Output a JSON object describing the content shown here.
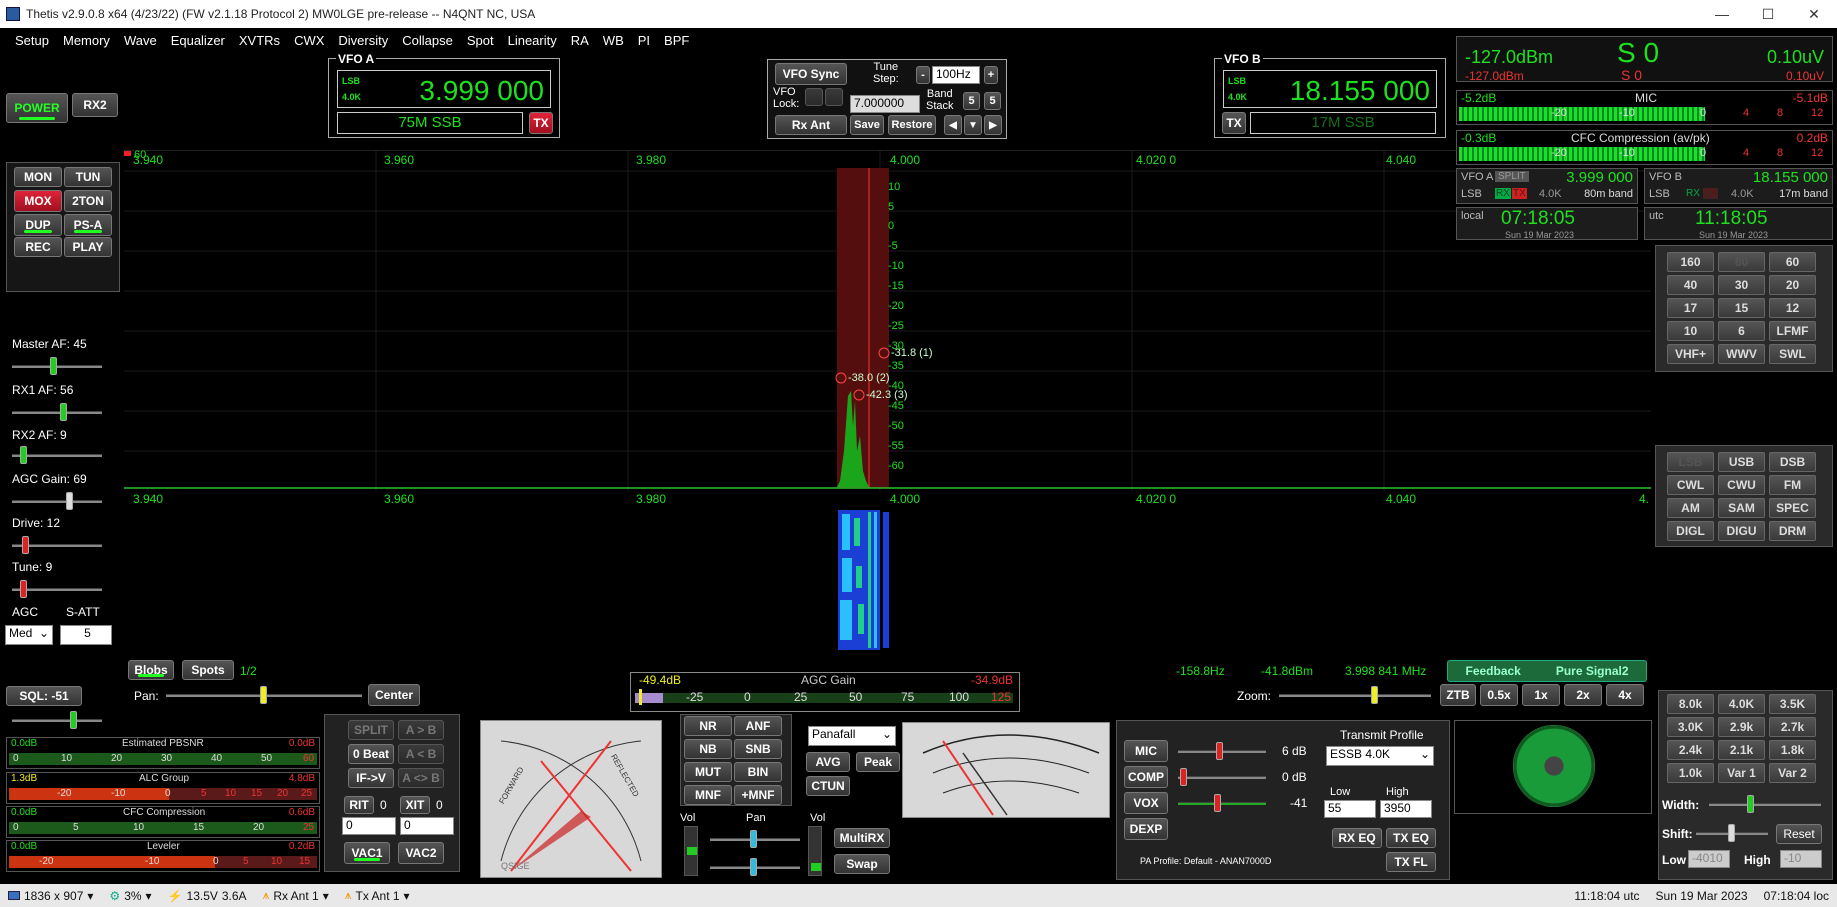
{
  "titlebar": {
    "title": "Thetis v2.9.0.8 x64 (4/23/22) (FW v2.1.18 Protocol 2) MW0LGE pre-release  --  N4QNT  NC, USA",
    "min": "—",
    "max": "☐",
    "close": "✕"
  },
  "menu": [
    "Setup",
    "Memory",
    "Wave",
    "Equalizer",
    "XVTRs",
    "CWX",
    "Diversity",
    "Collapse",
    "Spot",
    "Linearity",
    "RA",
    "WB",
    "PI",
    "BPF"
  ],
  "left": {
    "power": "POWER",
    "rx2": "RX2",
    "mon": "MON",
    "tun": "TUN",
    "mox": "MOX",
    "ton2": "2TON",
    "dup": "DUP",
    "psa": "PS-A",
    "rec": "REC",
    "play": "PLAY",
    "master_af": "Master AF:  45",
    "rx1_af": "RX1 AF:  56",
    "rx2_af": "RX2 AF:  9",
    "agc_gain": "AGC Gain:  69",
    "drive": "Drive:  12",
    "tune": "Tune:  9",
    "agc": "AGC",
    "satt": "S-ATT",
    "agc_mode": "Med",
    "satt_val": "5",
    "sql": "SQL:  -51"
  },
  "vfo_a": {
    "title": "VFO A",
    "mode": "LSB",
    "filter": "4.0K",
    "freq": "3.999 000",
    "band": "75M SSB",
    "tx": "TX"
  },
  "vfo_b": {
    "title": "VFO B",
    "mode": "LSB",
    "filter": "4.0K",
    "freq": "18.155 000",
    "band": "17M SSB",
    "tx": "TX"
  },
  "vfo_center": {
    "sync": "VFO Sync",
    "tune_step_label": "Tune\nStep:",
    "tune_step": "100Hz",
    "minus": "-",
    "plus": "+",
    "lock_label": "VFO\nLock:",
    "lock_val": "7.000000",
    "band_stack": "Band\nStack",
    "bs1": "5",
    "bs2": "5",
    "rx_ant": "Rx Ant",
    "save": "Save",
    "restore": "Restore"
  },
  "spectrum": {
    "x_labels": [
      "3.940",
      "3.960",
      "3.980",
      "4.000",
      "4.020 0",
      "4.040"
    ],
    "x_labels2": [
      "3.940",
      "3.960",
      "3.980",
      "4.000",
      "4.020 0",
      "4.040",
      "4."
    ],
    "y_labels": [
      "10",
      "5",
      "0",
      "-5",
      "-10",
      "-15",
      "-20",
      "-25",
      "-30",
      "-35",
      "-40",
      "-45",
      "-50",
      "-55",
      "-60"
    ],
    "blobs": [
      "-31.8 (1)",
      "-38.0 (2)",
      "-42.3 (3)"
    ],
    "top_marker": "60"
  },
  "lower_panadapter": {
    "blobs_btn": "Blobs",
    "spots_btn": "Spots",
    "page": "1/2",
    "pan": "Pan:",
    "center": "Center",
    "agc_left": "-49.4dB",
    "agc_title": "AGC Gain",
    "agc_right": "-34.9dB",
    "agc_ticks": [
      "-25",
      "0",
      "25",
      "50",
      "75",
      "100",
      "125"
    ],
    "cursor_hz": "-158.8Hz",
    "cursor_dbm": "-41.8dBm",
    "cursor_freq": "3.998 841 MHz",
    "zoom": "Zoom:",
    "ztb": "ZTB",
    "z05": "0.5x",
    "z1": "1x",
    "z2": "2x",
    "z4": "4x",
    "feedback": "Feedback",
    "pure_signal": "Pure Signal2"
  },
  "right_top": {
    "dbm": "-127.0dBm",
    "s": "S 0",
    "uv": "0.10uV",
    "dbm_red": "-127.0dBm",
    "s_red": "S 0",
    "uv_red": "0.10uV",
    "mic_left": "-5.2dB",
    "mic_title": "MIC",
    "mic_right": "-5.1dB",
    "cfc_left": "-0.3dB",
    "cfc_title": "CFC Compression (av/pk)",
    "cfc_right": "0.2dB",
    "mic_ticks": [
      "-20",
      "-10",
      "0",
      "4",
      "8",
      "12"
    ],
    "vfo_a_lbl": "VFO A",
    "split": "SPLIT",
    "vfo_a_freq": "3.999 000",
    "vfo_a_mode": "LSB",
    "vfo_a_rx": "RX",
    "vfo_a_tx": "TX",
    "vfo_a_filter": "4.0K",
    "vfo_a_band": "80m band",
    "vfo_b_lbl": "VFO B",
    "vfo_b_freq": "18.155 000",
    "vfo_b_mode": "LSB",
    "vfo_b_rx": "RX",
    "vfo_b_tx": "TX",
    "vfo_b_filter": "4.0K",
    "vfo_b_band": "17m band",
    "local_lbl": "local",
    "local_time": "07:18:05",
    "local_date": "Sun 19 Mar 2023",
    "utc_lbl": "utc",
    "utc_time": "11:18:05",
    "utc_date": "Sun 19 Mar 2023"
  },
  "bands": [
    "160",
    "80",
    "60",
    "40",
    "30",
    "20",
    "17",
    "15",
    "12",
    "10",
    "6",
    "LFMF",
    "VHF+",
    "WWV",
    "SWL"
  ],
  "modes": [
    "LSB",
    "USB",
    "DSB",
    "CWL",
    "CWU",
    "FM",
    "AM",
    "SAM",
    "SPEC",
    "DIGL",
    "DIGU",
    "DRM"
  ],
  "filters": [
    "8.0k",
    "4.0K",
    "3.5K",
    "3.0K",
    "2.9k",
    "2.7k",
    "2.4k",
    "2.1k",
    "1.8k",
    "1.0k",
    "Var 1",
    "Var 2"
  ],
  "filter_ctl": {
    "width": "Width:",
    "shift": "Shift:",
    "reset": "Reset",
    "low": "Low",
    "low_val": "-4010",
    "high": "High",
    "high_val": "-10"
  },
  "meters_left": [
    {
      "left": "0.0dB",
      "title": "Estimated PBSNR",
      "right": "0.0dB",
      "ticks": [
        "0",
        "10",
        "20",
        "30",
        "40",
        "50",
        "60"
      ]
    },
    {
      "left": "1.3dB",
      "title": "ALC Group",
      "right": "4.8dB",
      "ticks": [
        "-20",
        "-10",
        "0",
        "5",
        "10",
        "15",
        "20",
        "25"
      ]
    },
    {
      "left": "0.0dB",
      "title": "CFC Compression",
      "right": "0.6dB",
      "ticks": [
        "0",
        "5",
        "10",
        "15",
        "20",
        "25"
      ]
    },
    {
      "left": "0.0dB",
      "title": "Leveler",
      "right": "0.2dB",
      "ticks": [
        "-20",
        "-10",
        "0",
        "5",
        "10",
        "15"
      ]
    }
  ],
  "bottom_mid": {
    "split": "SPLIT",
    "a_b": "A > B",
    "b_a": "A < B",
    "a_x_b": "A <> B",
    "zero_beat": "0 Beat",
    "if_v": "IF->V",
    "rit": "RIT",
    "rit_v": "0",
    "xit": "XIT",
    "xit_v": "0",
    "rit_spin": "0",
    "xit_spin": "0",
    "vac1": "VAC1",
    "vac2": "VAC2",
    "nr": "NR",
    "anf": "ANF",
    "nb": "NB",
    "snb": "SNB",
    "mut": "MUT",
    "bin": "BIN",
    "mnf": "MNF",
    "pmnf": "+MNF",
    "display_mode": "Panafall",
    "avg": "AVG",
    "peak": "Peak",
    "ctun": "CTUN",
    "vol": "Vol",
    "pan": "Pan",
    "vol2": "Vol",
    "multirx": "MultiRX",
    "swap": "Swap",
    "swr_labels": [
      "FORWARD",
      "REFLECTED",
      "QSIGE"
    ]
  },
  "tx_panel": {
    "mic": "MIC",
    "mic_val": "6 dB",
    "comp": "COMP",
    "comp_val": "0 dB",
    "vox": "VOX",
    "vox_val": "-41",
    "dexp": "DEXP",
    "tx_profile": "Transmit Profile",
    "profile_val": "ESSB 4.0K",
    "low": "Low",
    "high": "High",
    "low_val": "55",
    "high_val": "3950",
    "rx_eq": "RX EQ",
    "tx_eq": "TX EQ",
    "tx_fl": "TX FL",
    "pa_profile": "PA Profile: Default - ANAN7000D"
  },
  "statusbar": {
    "res": "1836 x 907",
    "cpu": "3%",
    "volt": "13.5V",
    "amp": "3.6A",
    "rx_ant": "Rx Ant 1",
    "tx_ant": "Tx Ant 1",
    "utc": "11:18:04 utc",
    "date": "Sun 19 Mar 2023",
    "loc": "07:18:04 loc"
  },
  "colors": {
    "accent_green": "#1fe01f",
    "red": "#e0233a",
    "panel": "#161616"
  }
}
